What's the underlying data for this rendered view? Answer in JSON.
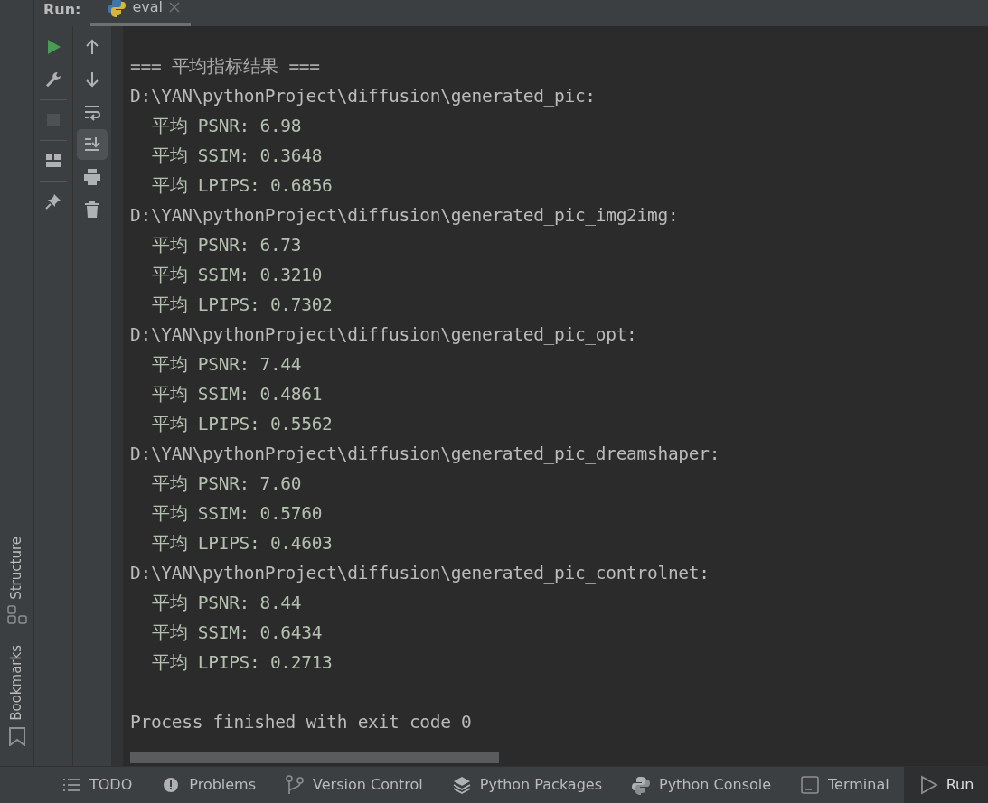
{
  "run_header": {
    "label": "Run:",
    "tabs": [
      {
        "label": "eval",
        "selected": true
      }
    ]
  },
  "side_tabs": [
    {
      "label": "Structure",
      "kind": "structure"
    },
    {
      "label": "Bookmarks",
      "kind": "bookmarks"
    }
  ],
  "main_toolbar": [
    {
      "kind": "run",
      "disabled": false
    },
    {
      "kind": "settings",
      "disabled": false
    },
    {
      "kind": "stop",
      "disabled": true
    },
    {
      "kind": "layout",
      "disabled": false
    },
    {
      "kind": "pin",
      "disabled": false
    }
  ],
  "console_toolbar": [
    {
      "kind": "up",
      "on": false
    },
    {
      "kind": "down",
      "on": false
    },
    {
      "kind": "wrap",
      "on": false
    },
    {
      "kind": "scroll-end",
      "on": true
    },
    {
      "kind": "print",
      "on": false
    },
    {
      "kind": "delete",
      "on": false
    }
  ],
  "console": {
    "lines": [
      {
        "kind": "header",
        "text": "=== 平均指标结果 ==="
      },
      {
        "kind": "path",
        "text": "D:\\YAN\\pythonProject\\diffusion\\generated_pic:"
      },
      {
        "kind": "metric",
        "text": "平均 PSNR: 6.98"
      },
      {
        "kind": "metric",
        "text": "平均 SSIM: 0.3648"
      },
      {
        "kind": "metric",
        "text": "平均 LPIPS: 0.6856"
      },
      {
        "kind": "path",
        "text": "D:\\YAN\\pythonProject\\diffusion\\generated_pic_img2img:"
      },
      {
        "kind": "metric",
        "text": "平均 PSNR: 6.73"
      },
      {
        "kind": "metric",
        "text": "平均 SSIM: 0.3210"
      },
      {
        "kind": "metric",
        "text": "平均 LPIPS: 0.7302"
      },
      {
        "kind": "path",
        "text": "D:\\YAN\\pythonProject\\diffusion\\generated_pic_opt:"
      },
      {
        "kind": "metric",
        "text": "平均 PSNR: 7.44"
      },
      {
        "kind": "metric",
        "text": "平均 SSIM: 0.4861"
      },
      {
        "kind": "metric",
        "text": "平均 LPIPS: 0.5562"
      },
      {
        "kind": "path",
        "text": "D:\\YAN\\pythonProject\\diffusion\\generated_pic_dreamshaper:"
      },
      {
        "kind": "metric",
        "text": "平均 PSNR: 7.60"
      },
      {
        "kind": "metric",
        "text": "平均 SSIM: 0.5760"
      },
      {
        "kind": "metric",
        "text": "平均 LPIPS: 0.4603"
      },
      {
        "kind": "path",
        "text": "D:\\YAN\\pythonProject\\diffusion\\generated_pic_controlnet:"
      },
      {
        "kind": "metric",
        "text": "平均 PSNR: 8.44"
      },
      {
        "kind": "metric",
        "text": "平均 SSIM: 0.6434"
      },
      {
        "kind": "metric",
        "text": "平均 LPIPS: 0.2713"
      },
      {
        "kind": "exit",
        "text": "Process finished with exit code 0"
      }
    ]
  },
  "bottom_tabs": [
    {
      "label": "TODO",
      "kind": "todo",
      "selected": false
    },
    {
      "label": "Problems",
      "kind": "problems",
      "selected": false
    },
    {
      "label": "Version Control",
      "kind": "vcs",
      "selected": false
    },
    {
      "label": "Python Packages",
      "kind": "packages",
      "selected": false
    },
    {
      "label": "Python Console",
      "kind": "python",
      "selected": false
    },
    {
      "label": "Terminal",
      "kind": "terminal",
      "selected": false
    },
    {
      "label": "Run",
      "kind": "run",
      "selected": true
    }
  ]
}
